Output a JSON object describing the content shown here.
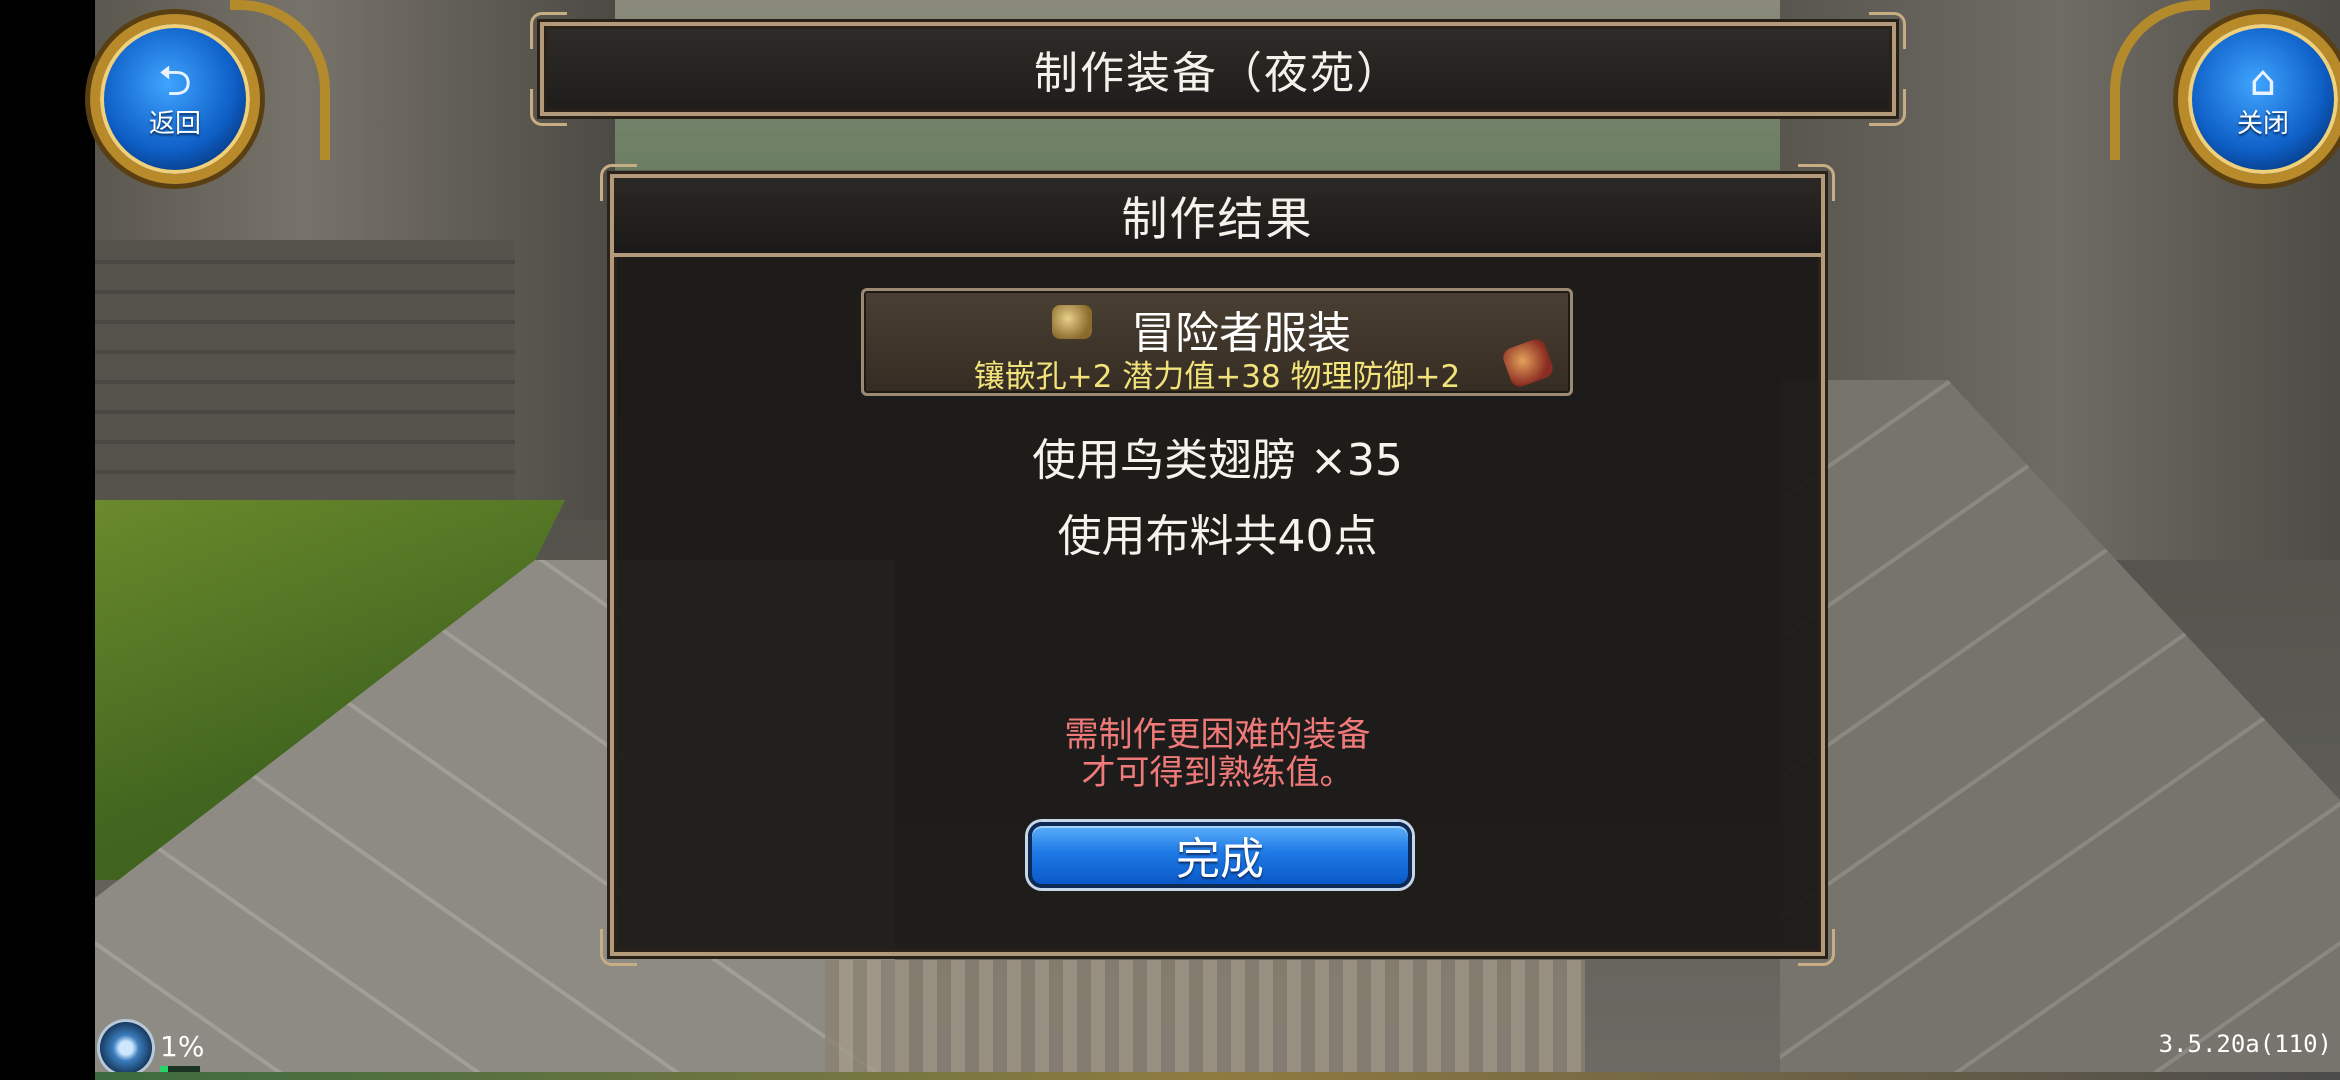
{
  "header": {
    "title": "制作装备（夜苑）"
  },
  "nav": {
    "back_label": "返回",
    "close_label": "关闭",
    "back_icon": "back-arrow-icon",
    "close_icon": "home-icon"
  },
  "dialog": {
    "title": "制作结果",
    "item": {
      "name": "冒险者服装",
      "stats": "镶嵌孔+2  潜力值+38  物理防御+2",
      "icon_left": "armor-icon",
      "icon_right": "equipment-icon"
    },
    "material_line": "使用鸟类翅膀 ×35",
    "cloth_line": "使用布料共40点",
    "warning_line1": "需制作更困难的装备",
    "warning_line2": "才可得到熟练值。",
    "done_button": "完成"
  },
  "status": {
    "percent": "1%",
    "progress": 0.01,
    "version": "3.5.20a(110)"
  },
  "colors": {
    "frame": "#b29a7a",
    "stats_text": "#f2e27a",
    "warning_text": "#f07a7a",
    "button_blue": "#1f7ae6",
    "round_button_blue": "#0e5fc6"
  }
}
